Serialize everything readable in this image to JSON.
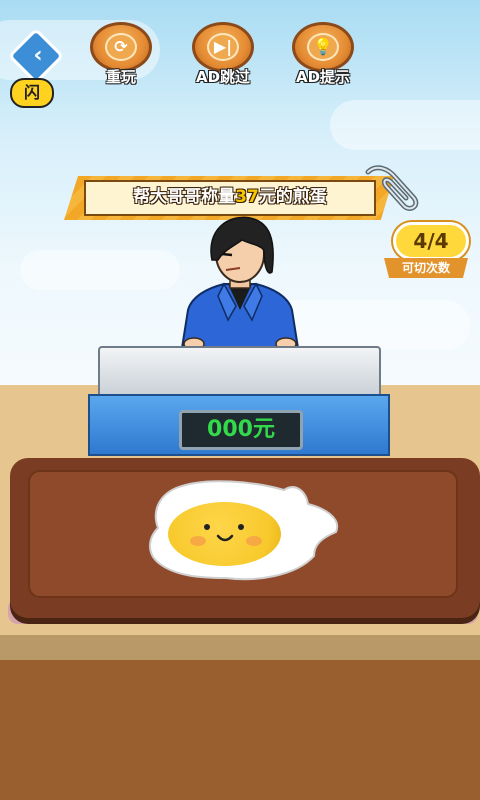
{
  "top_buttons": [
    {
      "label": "重玩",
      "icon": "replay-icon"
    },
    {
      "label": "AD跳过",
      "icon": "skip-icon"
    },
    {
      "label": "AD提示",
      "icon": "lightbulb-icon"
    }
  ],
  "back": {
    "icon": "back-arrow-icon",
    "badge": "闪"
  },
  "task": {
    "before": "帮大哥哥称量",
    "amount": "37",
    "after": "元的煎蛋"
  },
  "cuts": {
    "count": "4/4",
    "label": "可切次数"
  },
  "scale": {
    "display": "000元"
  },
  "colors": {
    "banner": "#f3a726",
    "scale_blue": "#2f79cf",
    "display_green": "#34d94b",
    "board": "#7a3d23"
  }
}
